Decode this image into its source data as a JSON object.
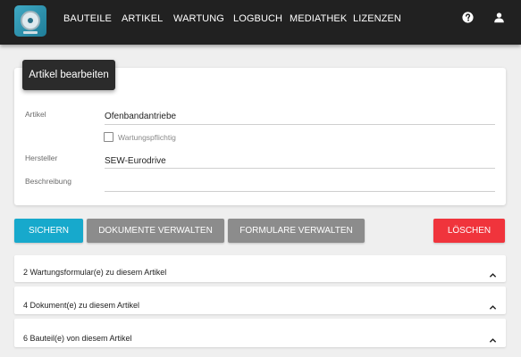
{
  "nav": {
    "logo": "safe-logo-icon",
    "items": [
      "BAUTEILE",
      "ARTIKEL",
      "WARTUNG",
      "LOGBUCH",
      "MEDIATHEK",
      "LIZENZEN"
    ],
    "help_icon": "help-icon",
    "user_icon": "user-icon"
  },
  "card": {
    "header": "Artikel bearbeiten",
    "fields": {
      "artikel_label": "Artikel",
      "artikel_value": "Ofenbandantriebe",
      "wartung_label": "Wartungspflichtig",
      "wartung_checked": false,
      "hersteller_label": "Hersteller",
      "hersteller_value": "SEW-Eurodrive",
      "beschreibung_label": "Beschreibung",
      "beschreibung_value": ""
    }
  },
  "buttons": {
    "save": "SICHERN",
    "documents": "DOKUMENTE VERWALTEN",
    "forms": "FORMULARE VERWALTEN",
    "delete": "LÖSCHEN"
  },
  "panels": [
    "2 Wartungsformular(e) zu diesem Artikel",
    "4 Dokument(e) zu diesem Artikel",
    "6 Bauteil(e) von diesem Artikel"
  ],
  "colors": {
    "navbar": "#212121",
    "save": "#17a9cc",
    "secondary": "#8c8c8c",
    "delete": "#f0343c",
    "page_bg": "#efefef"
  }
}
